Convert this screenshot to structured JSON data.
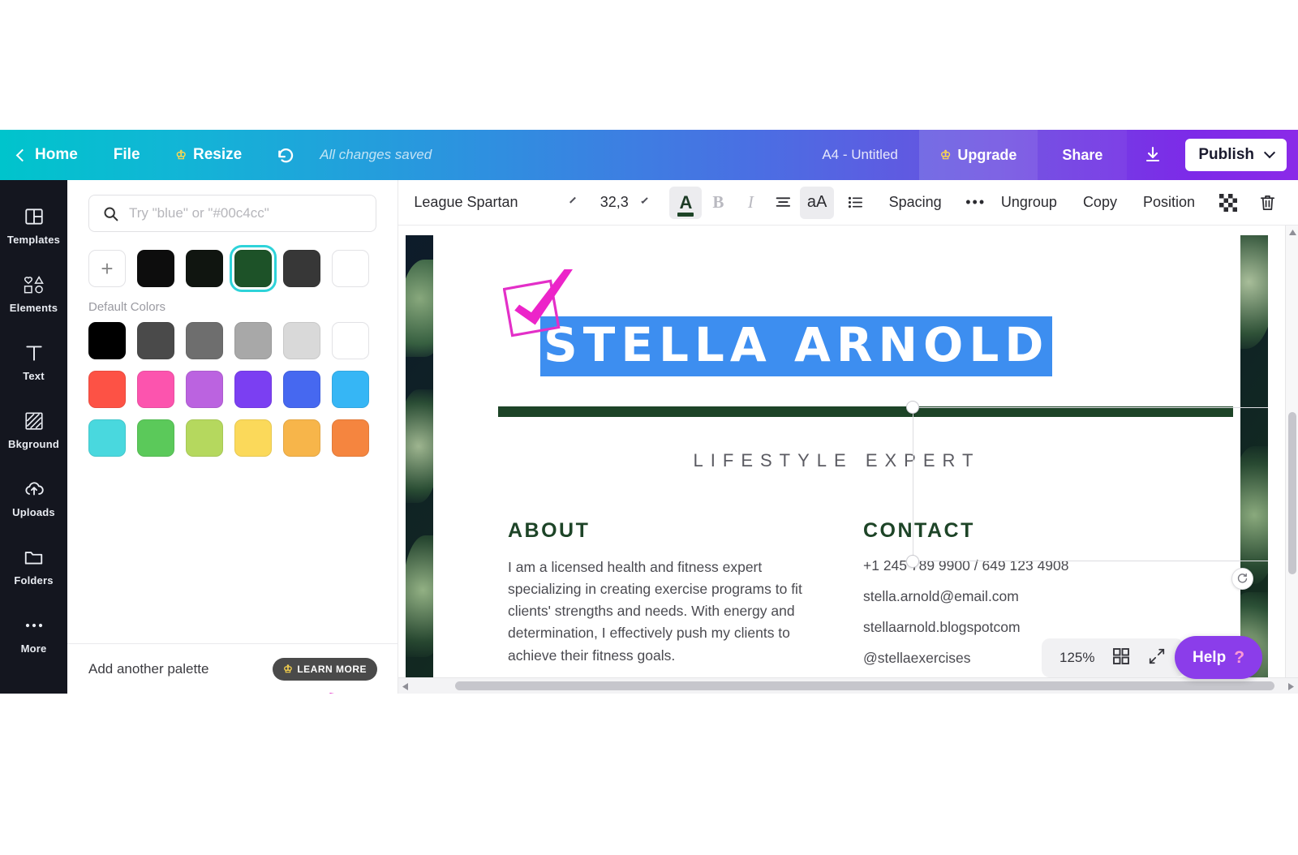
{
  "header": {
    "home_label": "Home",
    "file_label": "File",
    "resize_label": "Resize",
    "saved_status": "All changes saved",
    "doc_title": "A4 - Untitled",
    "upgrade_label": "Upgrade",
    "share_label": "Share",
    "publish_label": "Publish",
    "undo_icon": "undo-icon",
    "download_icon": "download-icon",
    "crown_icon": "crown-icon",
    "gradient_start": "#00c4cc",
    "gradient_end": "#8b2ae8"
  },
  "sidebar": {
    "items": [
      {
        "label": "Templates",
        "icon": "templates-icon"
      },
      {
        "label": "Elements",
        "icon": "elements-icon"
      },
      {
        "label": "Text",
        "icon": "text-icon"
      },
      {
        "label": "Bkground",
        "icon": "background-icon"
      },
      {
        "label": "Uploads",
        "icon": "uploads-icon"
      },
      {
        "label": "Folders",
        "icon": "folders-icon"
      },
      {
        "label": "More",
        "icon": "more-icon"
      }
    ]
  },
  "color_panel": {
    "search_placeholder": "Try \"blue\" or \"#00c4cc\"",
    "search_value": "",
    "search_icon": "search-icon",
    "add_color_label": "+",
    "document_colors": [
      "#0d0d0d",
      "#101510",
      "#1d5228",
      "#373737",
      "#ffffff"
    ],
    "selected_color": "#1d5228",
    "default_colors_label": "Default Colors",
    "default_colors": [
      "#000000",
      "#4a4a4a",
      "#6e6e6e",
      "#a8a8a8",
      "#d9d9d9",
      "#ffffff",
      "#fd5245",
      "#fc54ae",
      "#bb63e0",
      "#7b3ff2",
      "#4668f0",
      "#36b6f5",
      "#49d8de",
      "#5bc95a",
      "#b5d85e",
      "#fbd95a",
      "#f7b54a",
      "#f5853f"
    ],
    "add_palette_label": "Add another palette",
    "learn_more_label": "LEARN MORE"
  },
  "toolbar": {
    "font_family": "League Spartan",
    "font_size": "32,3",
    "text_color_icon": "text-color-icon",
    "bold_label": "B",
    "italic_label": "I",
    "align_icon": "align-center-icon",
    "case_label": "aA",
    "list_icon": "bullet-list-icon",
    "spacing_label": "Spacing",
    "more_label": "•••",
    "ungroup_label": "Ungroup",
    "copy_label": "Copy",
    "position_label": "Position",
    "transparency_icon": "transparency-icon",
    "delete_icon": "trash-icon"
  },
  "canvas": {
    "name": "STELLA ARNOLD",
    "subtitle": "LIFESTYLE EXPERT",
    "about": {
      "heading": "ABOUT",
      "body": "I am a licensed health and fitness expert specializing in creating exercise programs to fit clients' strengths and needs. With energy and determination, I effectively push my clients to achieve their fitness goals."
    },
    "contact": {
      "heading": "CONTACT",
      "lines": [
        "+1 245 789 9900 / 649 123 4908",
        "stella.arnold@email.com",
        "stellaarnold.blogspotcom",
        "@stellaexercises"
      ]
    },
    "accent_green": "#1d4427",
    "selection_highlight": "#3d8ef0",
    "rotate_icon": "rotate-icon"
  },
  "footer": {
    "zoom_level": "125%",
    "grid_icon": "grid-view-icon",
    "fullscreen_icon": "fullscreen-icon",
    "help_label": "Help",
    "help_mark": "?"
  }
}
